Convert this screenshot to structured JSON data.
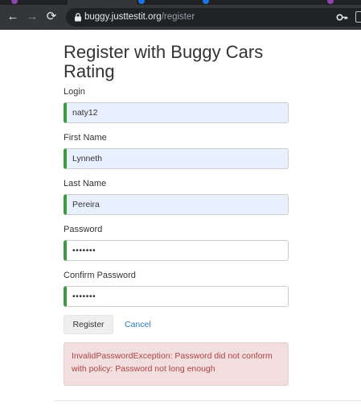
{
  "browser": {
    "url_host": "buggy.justtestit.org",
    "url_path": "/register",
    "icons": {
      "back": "arrow-left-icon",
      "forward": "arrow-right-icon",
      "reload": "reload-icon",
      "lock": "lock-icon",
      "key": "key-icon",
      "extension": "extension-icon"
    }
  },
  "page": {
    "title": "Register with Buggy Cars Rating"
  },
  "form": {
    "login": {
      "label": "Login",
      "value": "naty12"
    },
    "first_name": {
      "label": "First Name",
      "value": "Lynneth"
    },
    "last_name": {
      "label": "Last Name",
      "value": "Pereira"
    },
    "password": {
      "label": "Password",
      "value": "•••••••"
    },
    "confirm_password": {
      "label": "Confirm Password",
      "value": "•••••••"
    },
    "register_label": "Register",
    "cancel_label": "Cancel"
  },
  "alert": {
    "message": "InvalidPasswordException: Password did not conform with policy: Password not long enough"
  },
  "colors": {
    "valid_border": "#3c9b3c",
    "autofill_bg": "#e8f0fe",
    "alert_bg": "#f2dede",
    "alert_text": "#a94442",
    "link": "#2a7bbd",
    "chrome_bg": "#35363a"
  }
}
